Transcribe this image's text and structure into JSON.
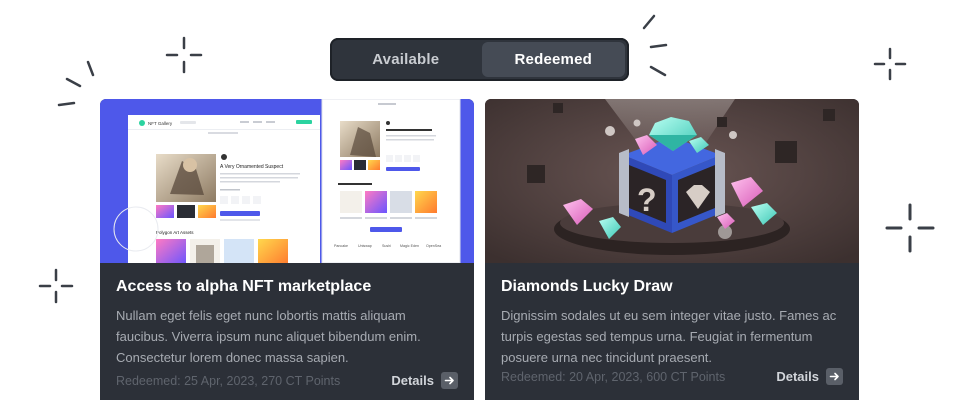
{
  "toggle": {
    "tabs": [
      {
        "label": "Available",
        "active": false
      },
      {
        "label": "Redeemed",
        "active": true
      }
    ]
  },
  "cards": [
    {
      "title": "Access to alpha NFT marketplace",
      "description": "Nullam eget felis eget nunc lobortis mattis aliquam faucibus. Viverra ipsum nunc aliquet bibendum enim. Consectetur lorem donec massa sapien.",
      "meta": "Redeemed: 25 Apr, 2023, 270 CT Points",
      "details_label": "Details",
      "preview": {
        "brand": "NFT Gallery",
        "heading": "A Very Ornamented Suspect",
        "section": "Polygon Art Assets",
        "partners": [
          "Pancake",
          "Uniswap",
          "Sushi",
          "Magic Eden",
          "OpenSea"
        ]
      }
    },
    {
      "title": "Diamonds Lucky Draw",
      "description": "Dignissim sodales ut eu sem integer vitae justo. Fames ac turpis egestas sed tempus urna. Feugiat in fermentum posuere urna nec tincidunt praesent.",
      "meta": "Redeemed: 20 Apr, 2023, 600 CT Points",
      "details_label": "Details"
    }
  ],
  "colors": {
    "card_bg": "#2c3038",
    "toggle_bg": "#2f343c",
    "active_tab": "#454b55",
    "hero_blue": "#4e58ea",
    "box_blue": "#3454d1",
    "gem_teal": "#6fe3d2",
    "gem_pink": "#f08cd4"
  },
  "icons": [
    "sparkle-icon",
    "burst-icon",
    "arrow-right-icon",
    "question-mark-icon",
    "diamond-icon"
  ]
}
